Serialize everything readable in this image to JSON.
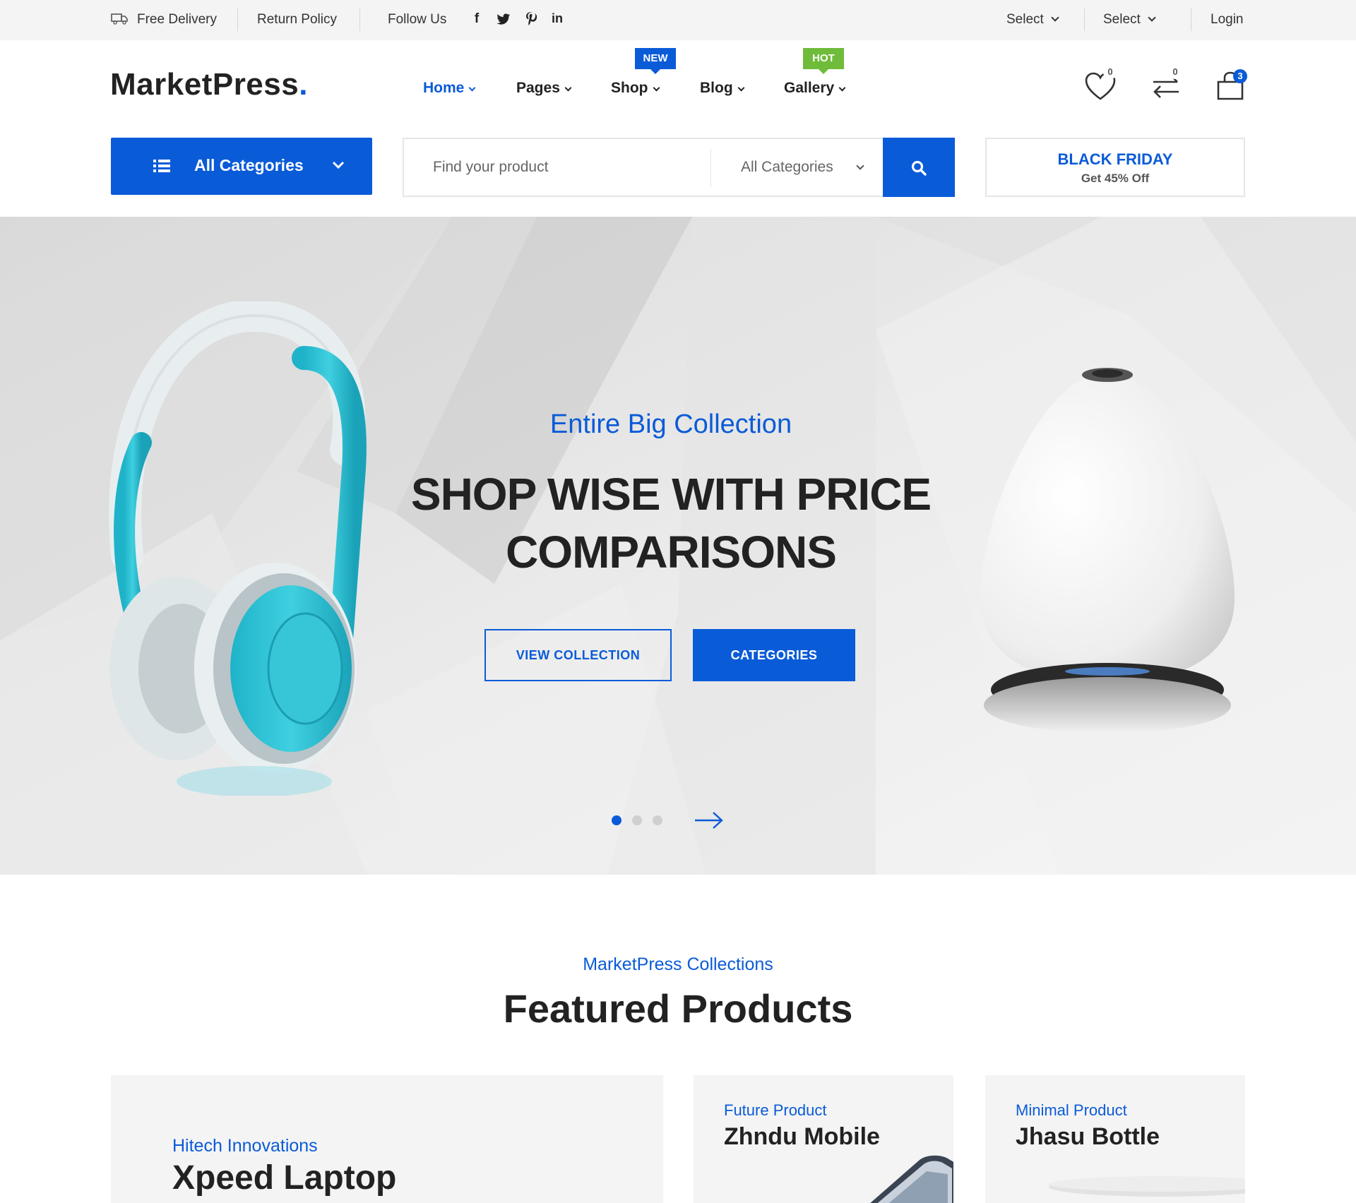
{
  "topbar": {
    "free_delivery": "Free Delivery",
    "return_policy": "Return Policy",
    "follow_us": "Follow Us",
    "social": [
      "facebook-icon",
      "twitter-icon",
      "pinterest-icon",
      "linkedin-icon"
    ],
    "social_glyphs": [
      "f",
      "t",
      "p",
      "in"
    ],
    "select_1": "Select",
    "select_2": "Select",
    "login": "Login"
  },
  "header": {
    "logo": "MarketPress",
    "logo_dot": ".",
    "nav": {
      "home": "Home",
      "pages": "Pages",
      "shop": "Shop",
      "blog": "Blog",
      "gallery": "Gallery"
    },
    "badges": {
      "shop": "NEW",
      "gallery": "HOT"
    },
    "wishlist_count": "0",
    "compare_count": "0",
    "cart_count": "3"
  },
  "search": {
    "all_categories_button": "All Categories",
    "placeholder": "Find your product",
    "category_select": "All Categories"
  },
  "promo": {
    "title": "BLACK FRIDAY",
    "subtitle": "Get 45% Off"
  },
  "hero": {
    "subtitle": "Entire Big Collection",
    "title_line1": "SHOP WISE WITH PRICE",
    "title_line2": "COMPARISONS",
    "button_view": "VIEW COLLECTION",
    "button_categories": "CATEGORIES",
    "slides_total": 3,
    "active_slide": 1
  },
  "featured": {
    "subtitle": "MarketPress Collections",
    "title": "Featured Products",
    "cards": [
      {
        "label": "Hitech Innovations",
        "name": "Xpeed Laptop"
      },
      {
        "label": "Future Product",
        "name": "Zhndu Mobile"
      },
      {
        "label": "Minimal Product",
        "name": "Jhasu Bottle"
      }
    ]
  },
  "colors": {
    "accent": "#0a5bd8",
    "hot": "#6fbb3a",
    "topbar_bg": "#f4f4f4",
    "card_bg": "#f4f4f4"
  }
}
